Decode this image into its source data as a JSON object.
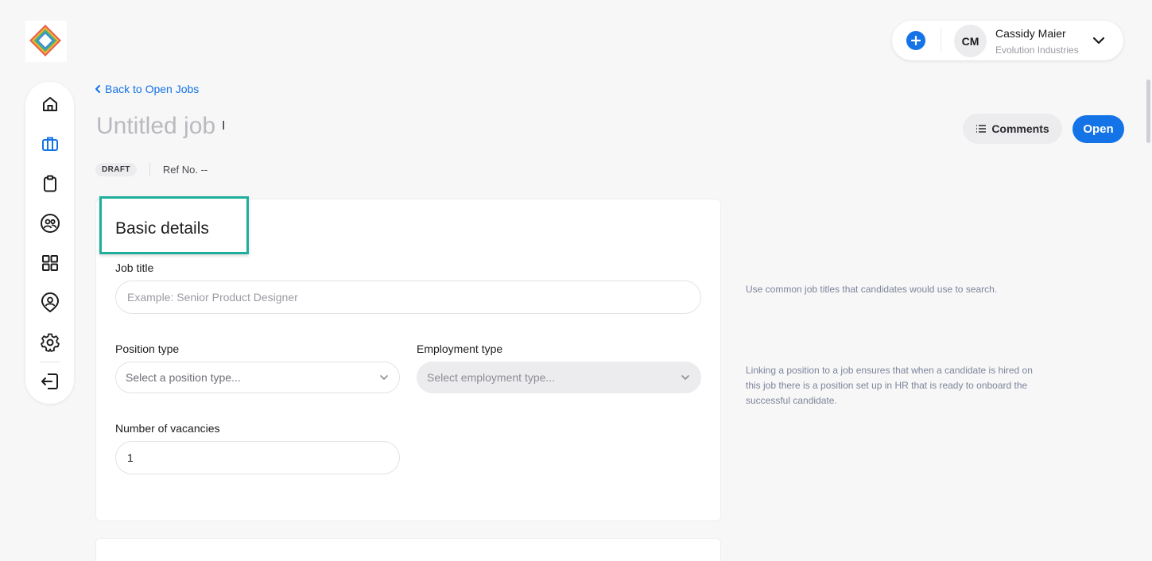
{
  "user": {
    "initials": "CM",
    "name": "Cassidy Maier",
    "organization": "Evolution Industries"
  },
  "header": {
    "back_link": "Back to Open Jobs",
    "job_title": "Untitled job",
    "status_badge": "DRAFT",
    "ref_no": "Ref No. --",
    "comments_label": "Comments",
    "open_label": "Open"
  },
  "basic_details": {
    "section_title": "Basic details",
    "job_title_label": "Job title",
    "job_title_placeholder": "Example: Senior Product Designer",
    "job_title_help": "Use common job titles that candidates would use to search.",
    "position_type_label": "Position type",
    "position_type_placeholder": "Select a position type...",
    "employment_type_label": "Employment type",
    "employment_type_placeholder": "Select employment type...",
    "position_help": "Linking a position to a job ensures that when a candidate is hired on this job there is a position set up in HR that is ready to onboard the successful candidate.",
    "vacancies_label": "Number of vacancies",
    "vacancies_value": "1"
  },
  "sidebar": {
    "items": [
      {
        "icon": "home-icon",
        "active": false
      },
      {
        "icon": "briefcase-icon",
        "active": true
      },
      {
        "icon": "clipboard-icon",
        "active": false
      },
      {
        "icon": "people-icon",
        "active": false
      },
      {
        "icon": "grid-icon",
        "active": false
      },
      {
        "icon": "location-person-icon",
        "active": false
      },
      {
        "icon": "gear-icon",
        "active": false
      },
      {
        "icon": "logout-icon",
        "active": false
      }
    ]
  },
  "colors": {
    "accent": "#1473e6",
    "highlight": "#1fae9c"
  }
}
